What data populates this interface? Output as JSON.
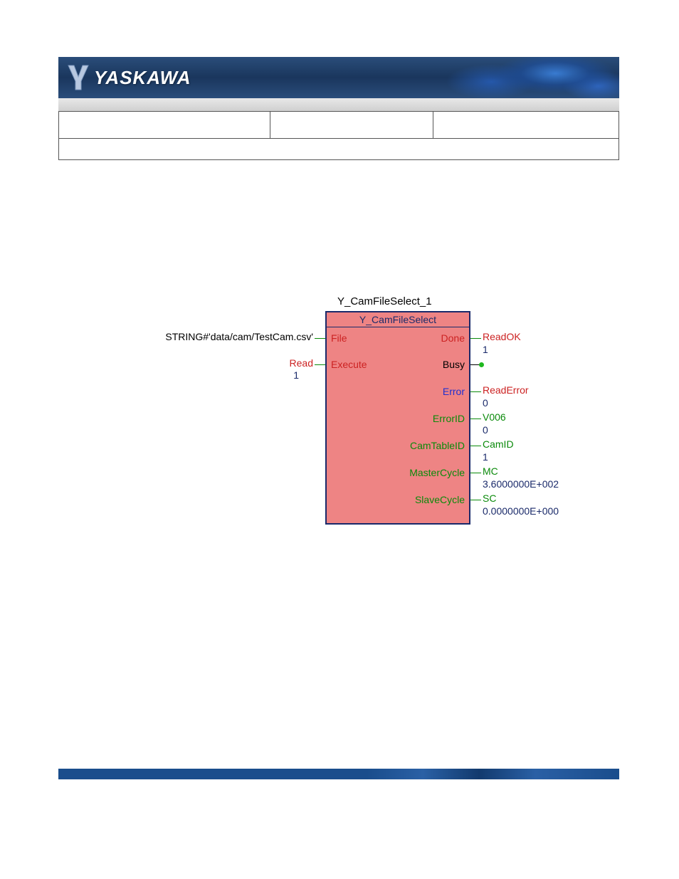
{
  "brand": "YASKAWA",
  "diagram": {
    "instance_name": "Y_CamFileSelect_1",
    "type_name": "Y_CamFileSelect",
    "inputs": {
      "file": {
        "port": "File",
        "value": "STRING#'data/cam/TestCam.csv'"
      },
      "execute": {
        "port": "Execute",
        "value": "Read",
        "sub": "1"
      }
    },
    "outputs": {
      "done": {
        "port": "Done",
        "value": "ReadOK",
        "sub": "1"
      },
      "busy": {
        "port": "Busy"
      },
      "error": {
        "port": "Error",
        "value": "ReadError",
        "sub": "0"
      },
      "errorid": {
        "port": "ErrorID",
        "value": "V006",
        "sub": "0"
      },
      "camtableid": {
        "port": "CamTableID",
        "value": "CamID",
        "sub": "1"
      },
      "mastercycle": {
        "port": "MasterCycle",
        "value": "MC",
        "sub": "3.6000000E+002"
      },
      "slavecycle": {
        "port": "SlaveCycle",
        "value": "SC",
        "sub": "0.0000000E+000"
      }
    }
  }
}
